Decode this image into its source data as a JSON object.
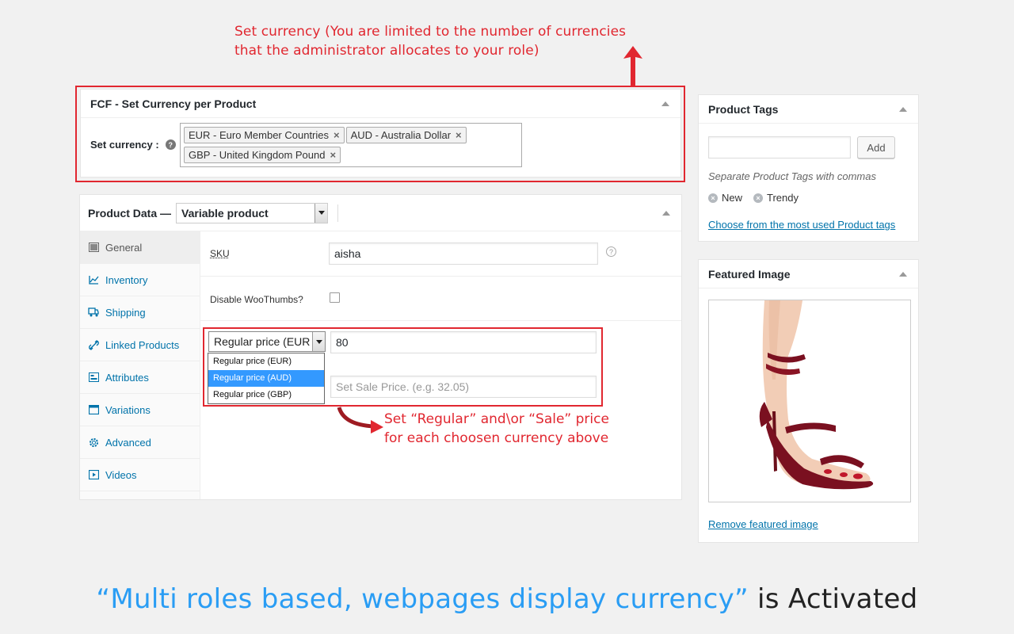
{
  "annotations": {
    "top_line1": "Set currency (You are limited to the number of currencies",
    "top_line2": "that the administrator allocates to your role)",
    "mid_line1": "Set “Regular” and\\or “Sale” price",
    "mid_line2": "for each choosen currency above",
    "bottom_blue": "“Multi roles based, webpages display currency”",
    "bottom_dark": " is Activated"
  },
  "fcf": {
    "title": "FCF - Set Currency per Product",
    "label": "Set currency :",
    "chips": [
      "EUR - Euro Member Countries",
      "AUD - Australia Dollar",
      "GBP - United Kingdom Pound"
    ]
  },
  "product_data": {
    "title": "Product Data —",
    "type_value": "Variable product",
    "tabs": [
      {
        "label": "General",
        "icon": "general-icon"
      },
      {
        "label": "Inventory",
        "icon": "inventory-icon"
      },
      {
        "label": "Shipping",
        "icon": "shipping-icon"
      },
      {
        "label": "Linked Products",
        "icon": "link-icon"
      },
      {
        "label": "Attributes",
        "icon": "attributes-icon"
      },
      {
        "label": "Variations",
        "icon": "variations-icon"
      },
      {
        "label": "Advanced",
        "icon": "gear-icon"
      },
      {
        "label": "Videos",
        "icon": "video-icon"
      }
    ],
    "sku_label": "SKU",
    "sku_value": "aisha",
    "woothumbs_label": "Disable WooThumbs?",
    "price_select": "Regular price (EUR",
    "price_options": [
      "Regular price (EUR)",
      "Regular price (AUD)",
      "Regular price (GBP)"
    ],
    "regular_price_value": "80",
    "sale_placeholder": "Set Sale Price. (e.g. 32.05)"
  },
  "tags": {
    "title": "Product Tags",
    "add_label": "Add",
    "hint": "Separate Product Tags with commas",
    "items": [
      "New",
      "Trendy"
    ],
    "choose_link": "Choose from the most used Product tags"
  },
  "featured": {
    "title": "Featured Image",
    "remove_link": "Remove featured image"
  },
  "colors": {
    "annotation_red": "#e12730",
    "link_blue": "#0073aa",
    "title_blue": "#2a9df4"
  }
}
